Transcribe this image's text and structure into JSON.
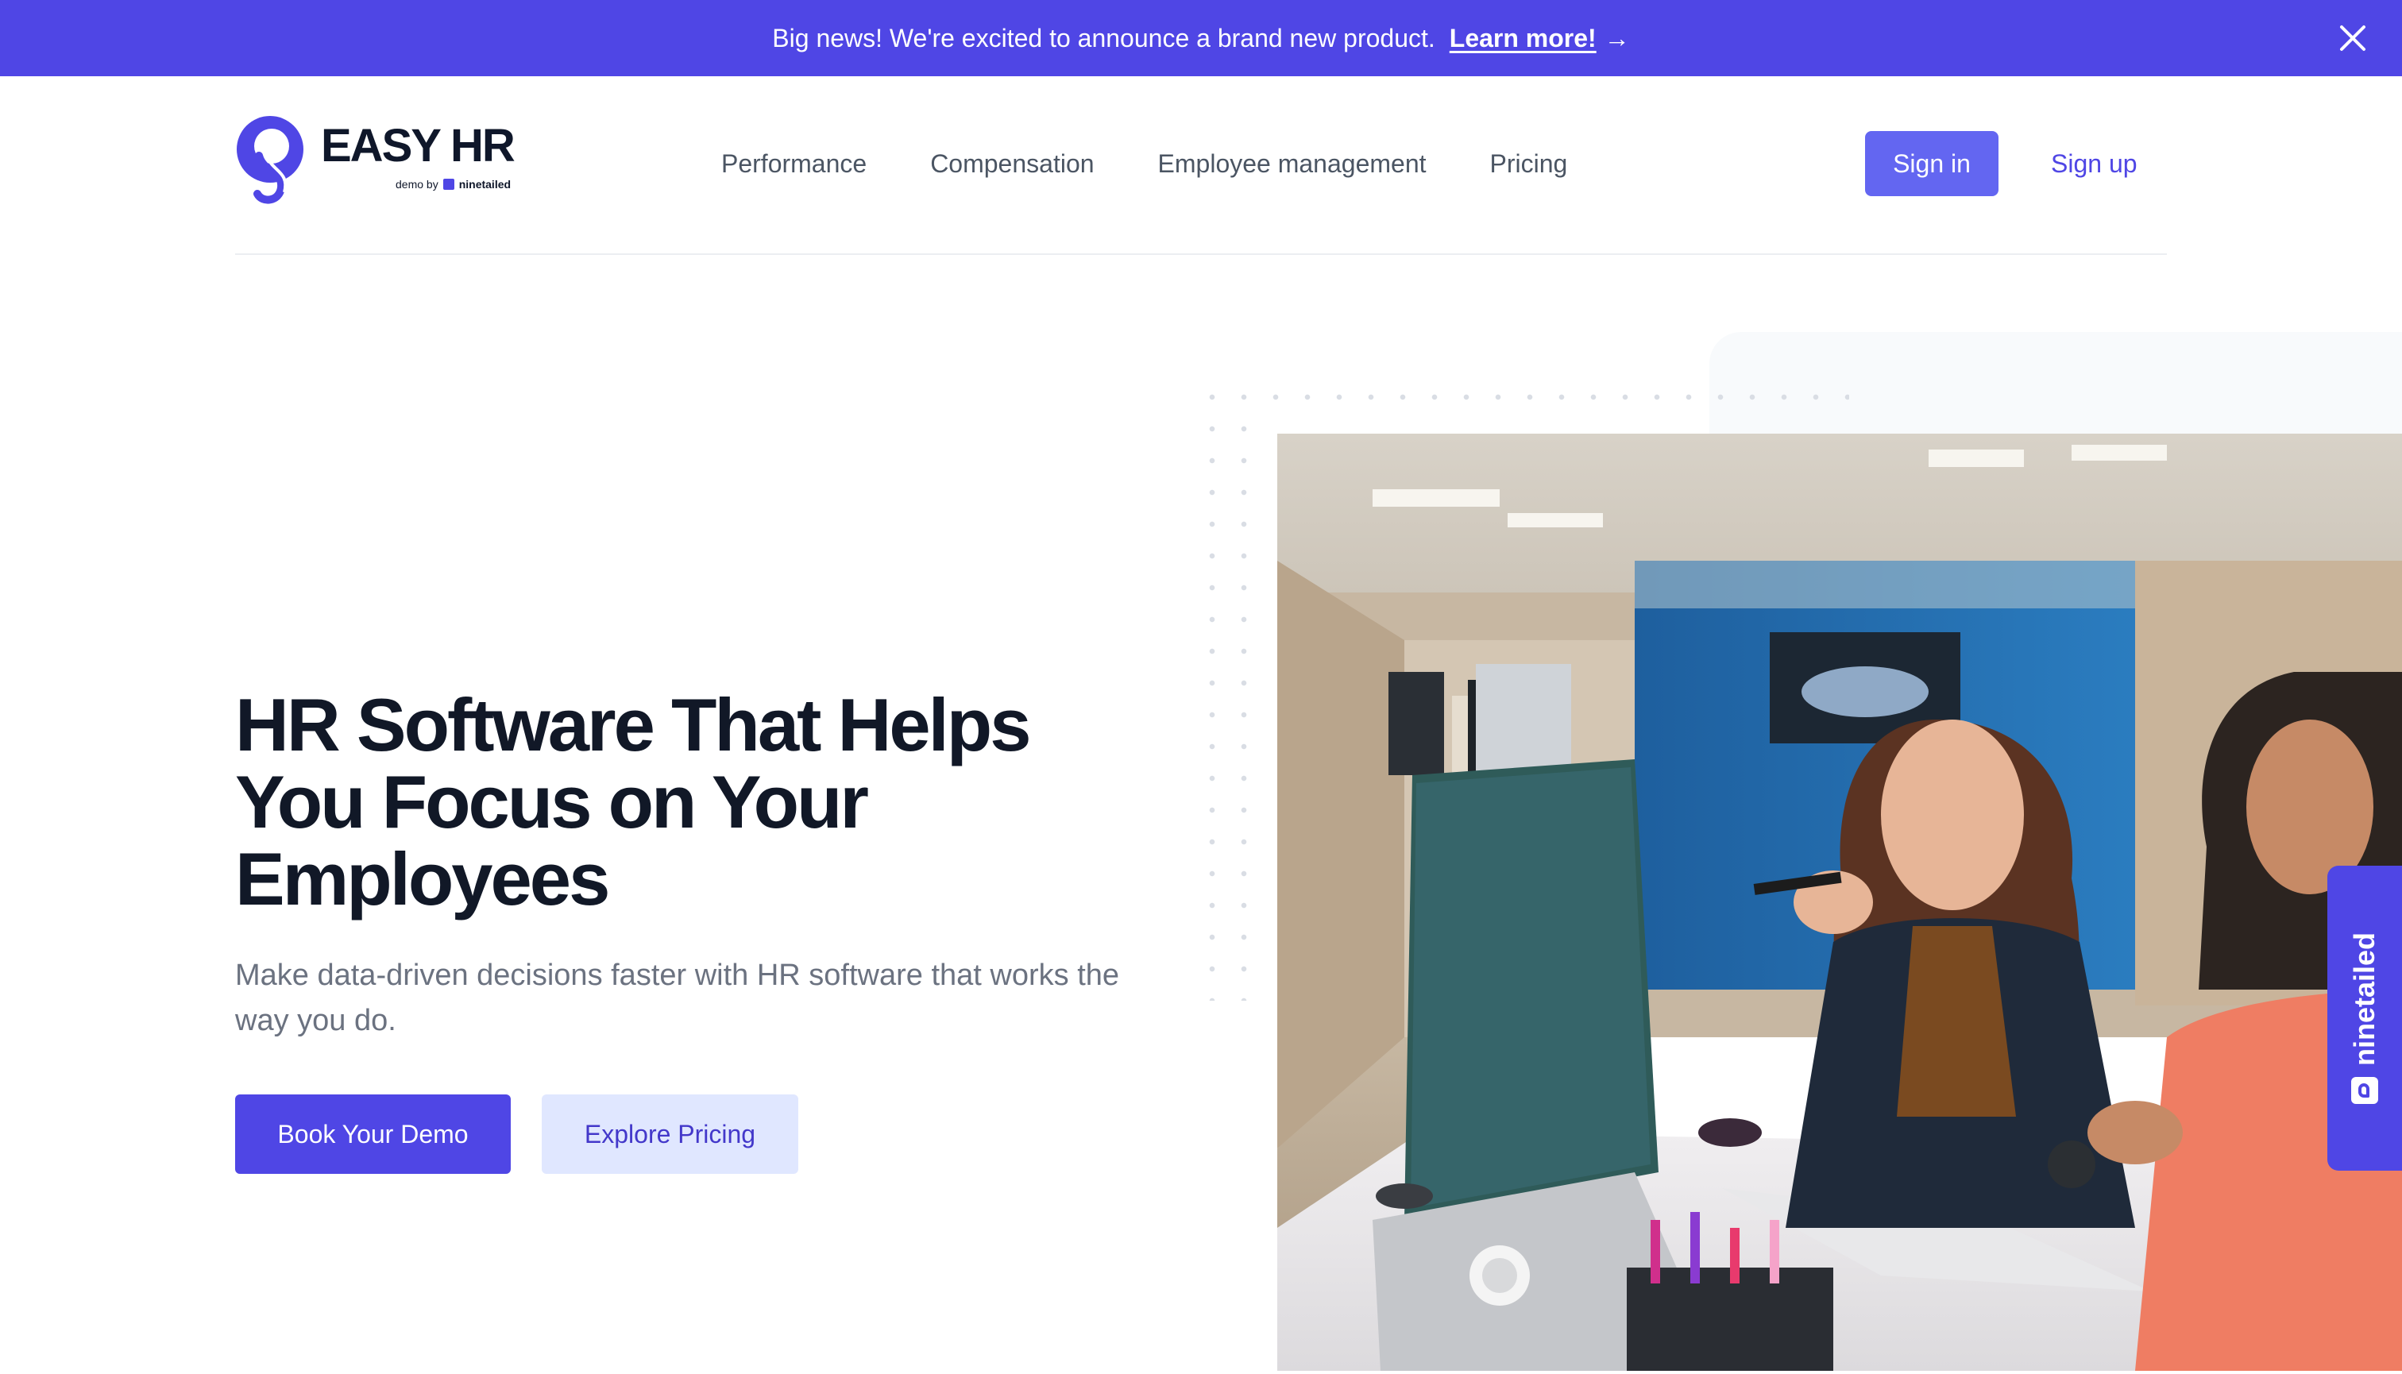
{
  "banner": {
    "message": "Big news! We're excited to announce a brand new product.",
    "link_label": "Learn more!",
    "arrow": "→"
  },
  "logo": {
    "name": "EASY HR",
    "sub_prefix": "demo by",
    "sub_brand": "ninetailed"
  },
  "nav": {
    "items": [
      "Performance",
      "Compensation",
      "Employee management",
      "Pricing"
    ]
  },
  "auth": {
    "sign_in": "Sign in",
    "sign_up": "Sign up"
  },
  "hero": {
    "title": "HR Software That Helps You Focus on Your Employees",
    "subtitle": "Make data-driven decisions faster with HR software that works the way you do.",
    "primary_cta": "Book Your Demo",
    "secondary_cta": "Explore Pricing"
  },
  "side_tab": {
    "label": "ninetailed"
  },
  "icons": {
    "close": "close-icon",
    "logo_mark": "easy-hr-logo-icon",
    "ninetailed": "ninetailed-icon"
  },
  "colors": {
    "brand": "#4f46e5",
    "signin": "#6366f1",
    "secondary_button_bg": "#e0e7ff",
    "heading": "#111827",
    "nav_text": "#4b5563"
  }
}
